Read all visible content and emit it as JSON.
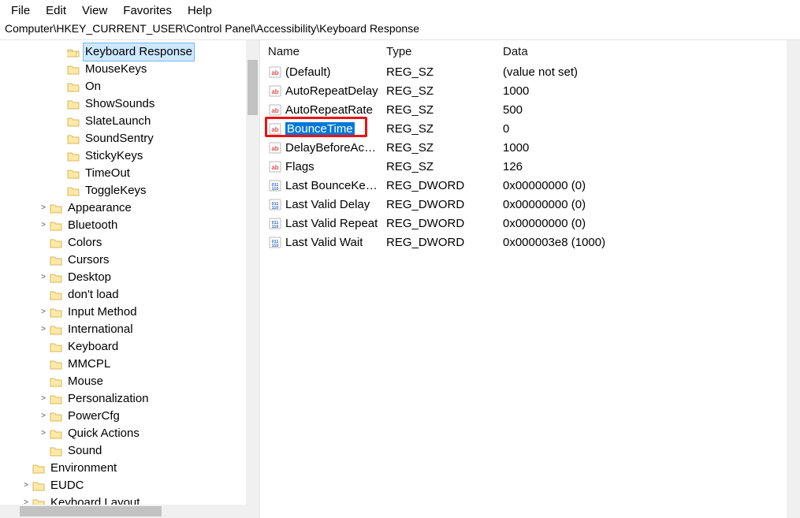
{
  "menubar": [
    "File",
    "Edit",
    "View",
    "Favorites",
    "Help"
  ],
  "address": "Computer\\HKEY_CURRENT_USER\\Control Panel\\Accessibility\\Keyboard Response",
  "tree": [
    {
      "label": "Keyboard Response",
      "indent": 4,
      "expander": "",
      "selected": true,
      "open": true
    },
    {
      "label": "MouseKeys",
      "indent": 4,
      "expander": ""
    },
    {
      "label": "On",
      "indent": 4,
      "expander": ""
    },
    {
      "label": "ShowSounds",
      "indent": 4,
      "expander": ""
    },
    {
      "label": "SlateLaunch",
      "indent": 4,
      "expander": ""
    },
    {
      "label": "SoundSentry",
      "indent": 4,
      "expander": ""
    },
    {
      "label": "StickyKeys",
      "indent": 4,
      "expander": ""
    },
    {
      "label": "TimeOut",
      "indent": 4,
      "expander": ""
    },
    {
      "label": "ToggleKeys",
      "indent": 4,
      "expander": ""
    },
    {
      "label": "Appearance",
      "indent": 3,
      "expander": ">"
    },
    {
      "label": "Bluetooth",
      "indent": 3,
      "expander": ">"
    },
    {
      "label": "Colors",
      "indent": 3,
      "expander": ""
    },
    {
      "label": "Cursors",
      "indent": 3,
      "expander": ""
    },
    {
      "label": "Desktop",
      "indent": 3,
      "expander": ">"
    },
    {
      "label": "don't load",
      "indent": 3,
      "expander": ""
    },
    {
      "label": "Input Method",
      "indent": 3,
      "expander": ">"
    },
    {
      "label": "International",
      "indent": 3,
      "expander": ">"
    },
    {
      "label": "Keyboard",
      "indent": 3,
      "expander": ""
    },
    {
      "label": "MMCPL",
      "indent": 3,
      "expander": ""
    },
    {
      "label": "Mouse",
      "indent": 3,
      "expander": ""
    },
    {
      "label": "Personalization",
      "indent": 3,
      "expander": ">"
    },
    {
      "label": "PowerCfg",
      "indent": 3,
      "expander": ">"
    },
    {
      "label": "Quick Actions",
      "indent": 3,
      "expander": ">"
    },
    {
      "label": "Sound",
      "indent": 3,
      "expander": ""
    },
    {
      "label": "Environment",
      "indent": 2,
      "expander": ""
    },
    {
      "label": "EUDC",
      "indent": 2,
      "expander": ">"
    },
    {
      "label": "Keyboard Layout",
      "indent": 2,
      "expander": ">"
    }
  ],
  "columns": {
    "name": "Name",
    "type": "Type",
    "data": "Data"
  },
  "values": [
    {
      "name": "(Default)",
      "type": "REG_SZ",
      "data": "(value not set)",
      "icon": "sz"
    },
    {
      "name": "AutoRepeatDelay",
      "type": "REG_SZ",
      "data": "1000",
      "icon": "sz"
    },
    {
      "name": "AutoRepeatRate",
      "type": "REG_SZ",
      "data": "500",
      "icon": "sz"
    },
    {
      "name": "BounceTime",
      "type": "REG_SZ",
      "data": "0",
      "icon": "sz",
      "selected": true,
      "highlighted": true
    },
    {
      "name": "DelayBeforeAcc...",
      "type": "REG_SZ",
      "data": "1000",
      "icon": "sz"
    },
    {
      "name": "Flags",
      "type": "REG_SZ",
      "data": "126",
      "icon": "sz"
    },
    {
      "name": "Last BounceKey ...",
      "type": "REG_DWORD",
      "data": "0x00000000 (0)",
      "icon": "dw"
    },
    {
      "name": "Last Valid Delay",
      "type": "REG_DWORD",
      "data": "0x00000000 (0)",
      "icon": "dw"
    },
    {
      "name": "Last Valid Repeat",
      "type": "REG_DWORD",
      "data": "0x00000000 (0)",
      "icon": "dw"
    },
    {
      "name": "Last Valid Wait",
      "type": "REG_DWORD",
      "data": "0x000003e8 (1000)",
      "icon": "dw"
    }
  ]
}
